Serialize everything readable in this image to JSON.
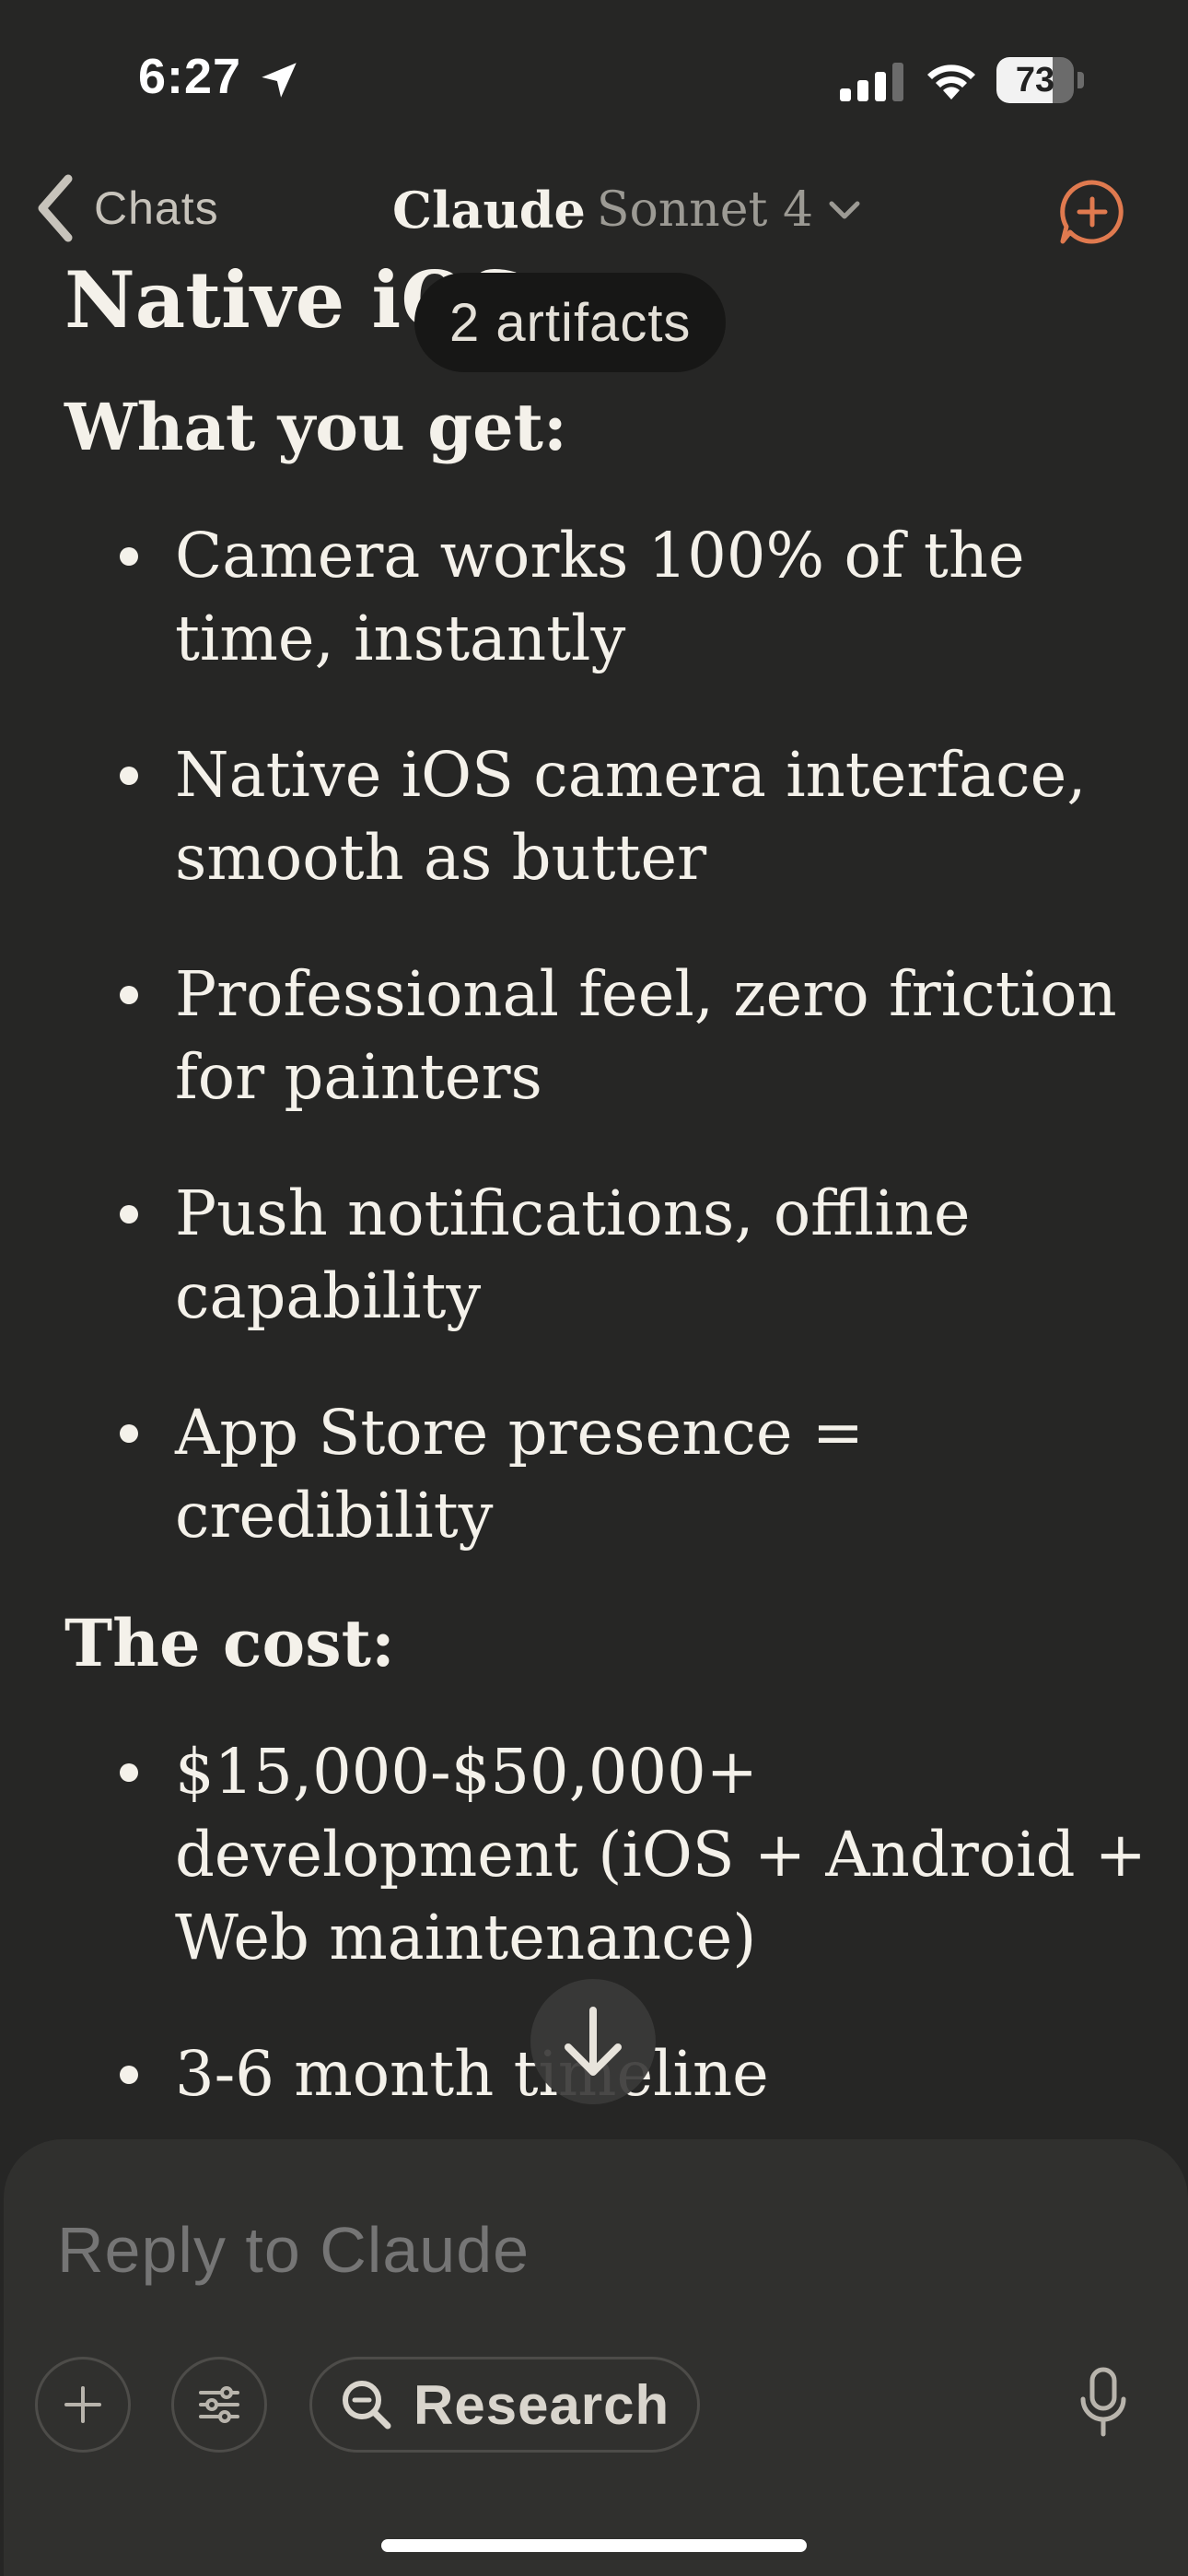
{
  "status_bar": {
    "time": "6:27",
    "battery": "73",
    "battery_level_percent": 73,
    "icons": [
      "location-arrow-icon",
      "cellular-signal-icon",
      "wifi-icon",
      "battery-icon"
    ]
  },
  "nav": {
    "back_label": "Chats",
    "model_name": "Claude",
    "model_variant": "Sonnet 4",
    "icons": [
      "chevron-left-icon",
      "chevron-down-icon",
      "new-chat-icon"
    ]
  },
  "message": {
    "partial_heading": "Native iOS",
    "artifacts_badge": "2 artifacts",
    "section1_heading": "What you get:",
    "section1_items": [
      "Camera works 100% of the time, instantly",
      "Native iOS camera interface, smooth as butter",
      "Professional feel, zero friction for painters",
      "Push notifications, offline capability",
      "App Store presence = credibility"
    ],
    "section2_heading": "The cost:",
    "section2_items": [
      "$15,000-$50,000+ development (iOS + Android + Web maintenance)",
      "3-6 month timeline"
    ]
  },
  "composer": {
    "placeholder": "Reply to Claude",
    "research_label": "Research",
    "icons": [
      "plus-icon",
      "sliders-icon",
      "research-search-icon",
      "microphone-icon",
      "arrow-down-icon"
    ]
  },
  "colors": {
    "background": "#262625",
    "composer": "#30302e",
    "accent": "#e07a4f",
    "text": "#f4f1ea"
  }
}
